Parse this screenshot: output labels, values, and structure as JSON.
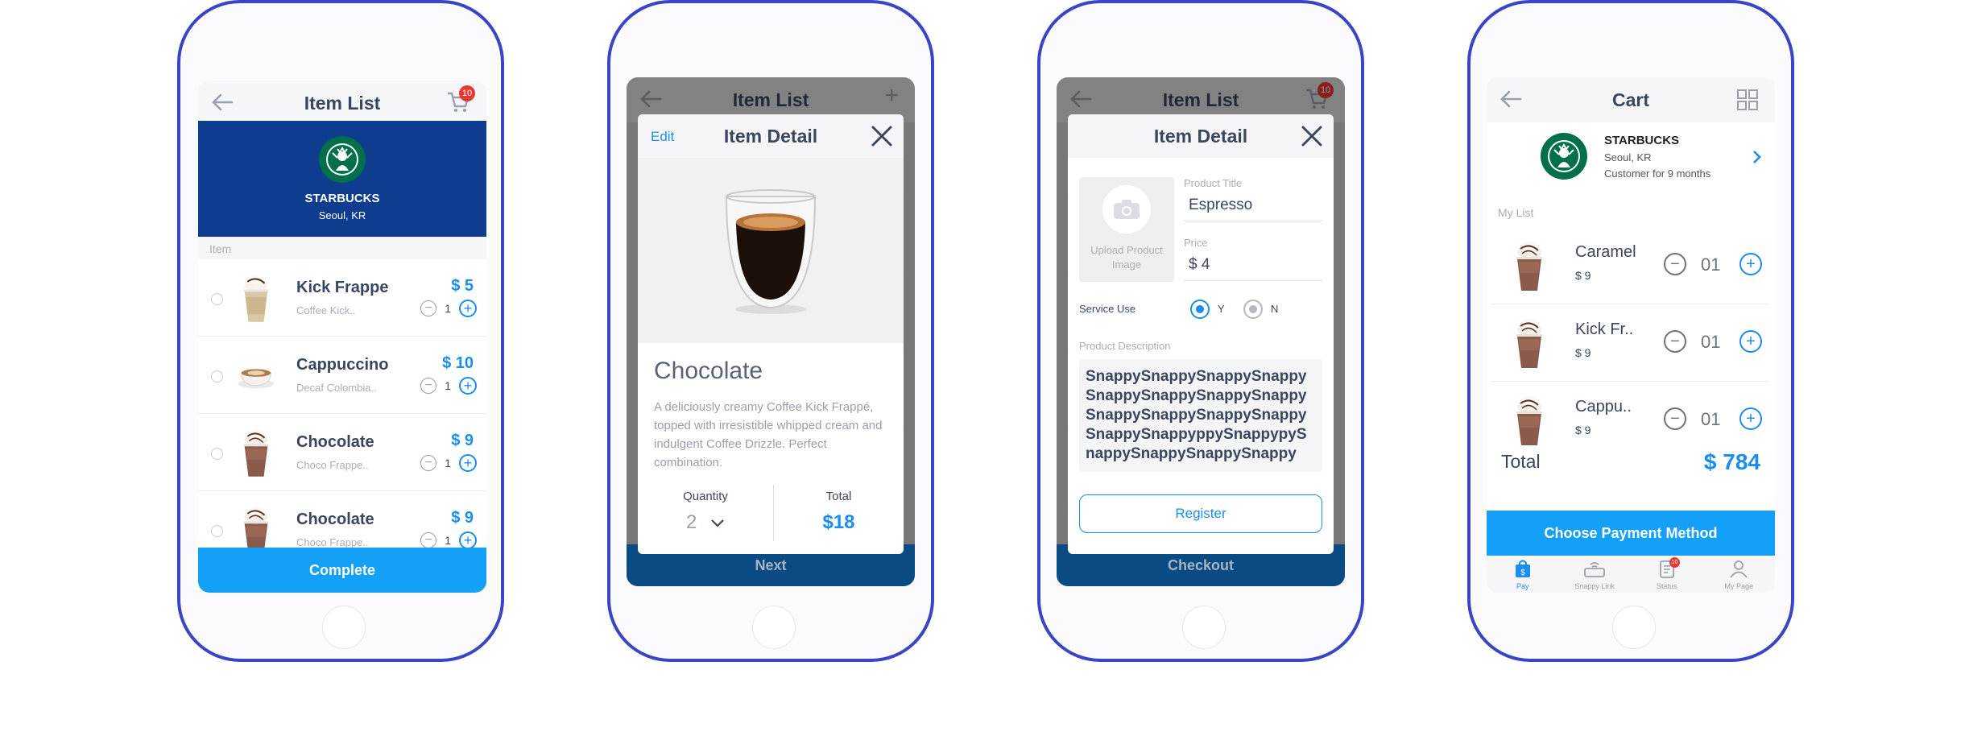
{
  "screen1": {
    "title": "Item List",
    "cart_badge": "10",
    "store_name": "STARBUCKS",
    "store_location": "Seoul, KR",
    "section_label": "Item",
    "items": [
      {
        "name": "Kick Frappe",
        "desc": "Coffee Kick..",
        "price": "$ 5",
        "qty": "1"
      },
      {
        "name": "Cappuccino",
        "desc": "Decaf Colombia..",
        "price": "$ 10",
        "qty": "1"
      },
      {
        "name": "Chocolate",
        "desc": "Choco Frappe..",
        "price": "$ 9",
        "qty": "1"
      },
      {
        "name": "Chocolate",
        "desc": "Choco Frappe..",
        "price": "$ 9",
        "qty": "1"
      }
    ],
    "button": "Complete",
    "colors": {
      "brand": "#0e3d8f",
      "accent": "#14a0f7"
    }
  },
  "screen2": {
    "bg_title": "Item List",
    "edit": "Edit",
    "title": "Item Detail",
    "product_name": "Chocolate",
    "description": "A deliciously creamy Coffee Kick Frappé, topped with irresistible whipped cream and indulgent Coffee Drizzle. Perfect combination.",
    "quantity_label": "Quantity",
    "quantity_value": "2",
    "total_label": "Total",
    "total_value": "$18",
    "button": "Next"
  },
  "screen3": {
    "bg_title": "Item List",
    "cart_badge": "10",
    "title": "Item Detail",
    "upload_label": "Upload Product Image",
    "product_title_label": "Product Title",
    "product_title_value": "Espresso",
    "price_label": "Price",
    "price_value": "$ 4",
    "service_use_label": "Service Use",
    "option_y": "Y",
    "option_n": "N",
    "description_label": "Product Description",
    "description_value": "SnappySnappySnappySnappySnappySnappySnappySnappySnappySnappySnappySnappySnappySnappyppySnappypySnappySnappySnappySnappy",
    "register_button": "Register",
    "button": "Checkout"
  },
  "screen4": {
    "title": "Cart",
    "store_name": "STARBUCKS",
    "store_location": "Seoul, KR",
    "customer_since": "Customer for 9 months",
    "section_label": "My List",
    "items": [
      {
        "name": "Caramel",
        "price": "$ 9",
        "qty": "01"
      },
      {
        "name": "Kick Fr..",
        "price": "$ 9",
        "qty": "01"
      },
      {
        "name": "Cappu..",
        "price": "$ 9",
        "qty": "01"
      }
    ],
    "total_label": "Total",
    "total_value": "$ 784",
    "button": "Choose Payment Method",
    "tabs": [
      {
        "label": "Pay",
        "icon": "shopping-bag-icon"
      },
      {
        "label": "Snappy Link",
        "icon": "wireless-pad-icon"
      },
      {
        "label": "Status",
        "icon": "clipboard-icon"
      },
      {
        "label": "My Page",
        "icon": "person-icon"
      }
    ],
    "status_badge": "10"
  }
}
